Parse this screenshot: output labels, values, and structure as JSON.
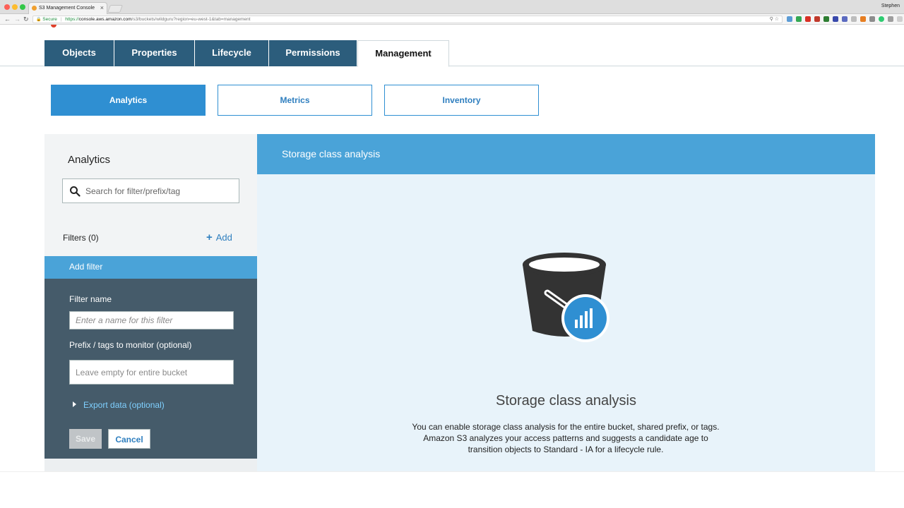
{
  "browser": {
    "tab_title": "S3 Management Console",
    "tab_close": "×",
    "profile_name": "Stephen",
    "nav_back": "←",
    "nav_forward": "→",
    "nav_reload": "↻",
    "secure_icon": "🔒",
    "secure_label": "Secure",
    "url_protocol": "https://",
    "url_host": "console.aws.amazon.com",
    "url_path": "/s3/buckets/wildguru?region=eu-west-1&tab=management",
    "url_icons": "⚲  ☆"
  },
  "main_tabs": [
    {
      "label": "Objects"
    },
    {
      "label": "Properties"
    },
    {
      "label": "Lifecycle"
    },
    {
      "label": "Permissions"
    },
    {
      "label": "Management"
    }
  ],
  "sub_tabs": [
    {
      "label": "Analytics",
      "active": true
    },
    {
      "label": "Metrics"
    },
    {
      "label": "Inventory"
    }
  ],
  "left_panel": {
    "title": "Analytics",
    "search_placeholder": "Search for filter/prefix/tag",
    "filters_label": "Filters (0)",
    "add_plus": "+",
    "add_label": "Add",
    "add_filter": {
      "heading": "Add filter",
      "filter_name_label": "Filter name",
      "filter_name_placeholder": "Enter a name for this filter",
      "prefix_label": "Prefix / tags to monitor (optional)",
      "prefix_placeholder": "Leave empty for entire bucket",
      "export_label": "Export data (optional)",
      "save_label": "Save",
      "cancel_label": "Cancel"
    }
  },
  "right_panel": {
    "header": "Storage class analysis",
    "illustration_icon": "bucket-analytics-icon",
    "title": "Storage class analysis",
    "description": "You can enable storage class analysis for the entire bucket, shared prefix, or tags. Amazon S3 analyzes your access patterns and suggests a candidate age to transition objects to Standard - IA for a lifecycle rule."
  },
  "colors": {
    "tab_dark": "#2c5d7c",
    "accent_blue": "#2f8fd2",
    "header_blue": "#4aa3d8",
    "panel_dark": "#455b6a",
    "right_bg": "#e8f3fa"
  }
}
